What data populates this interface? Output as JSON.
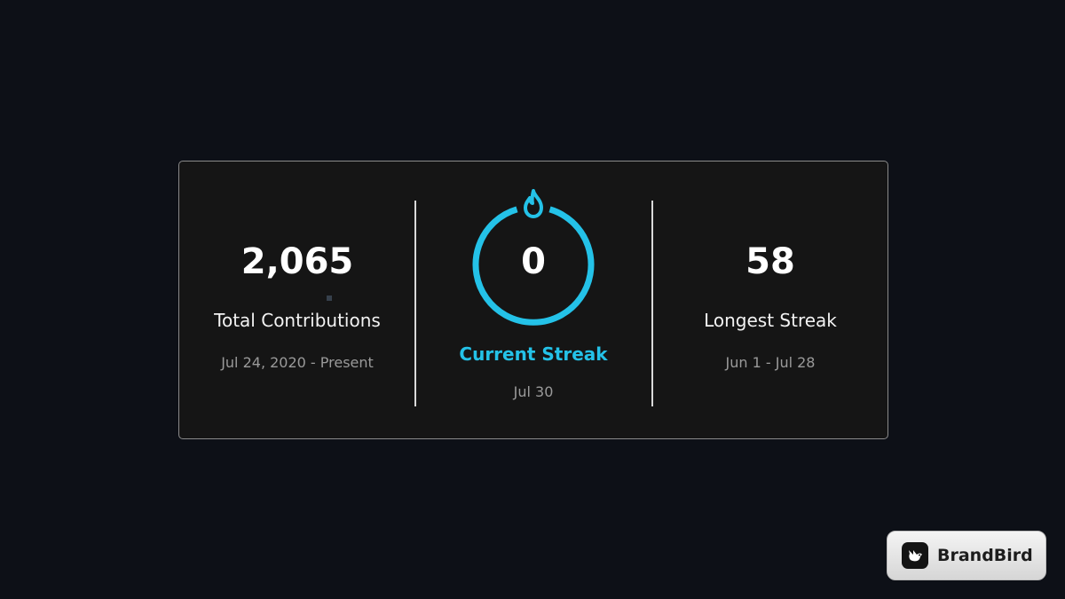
{
  "stats": {
    "total": {
      "value": "2,065",
      "label": "Total Contributions",
      "range": "Jul 24, 2020 - Present"
    },
    "current": {
      "value": "0",
      "label": "Current Streak",
      "range": "Jul 30"
    },
    "longest": {
      "value": "58",
      "label": "Longest Streak",
      "range": "Jun 1 - Jul 28"
    }
  },
  "colors": {
    "accent": "#24c2e8",
    "background": "#0d1017",
    "card": "#151515"
  },
  "icons": {
    "streak": "fire-icon",
    "brand": "bird-logo-icon"
  },
  "watermark": {
    "text": "BrandBird"
  }
}
